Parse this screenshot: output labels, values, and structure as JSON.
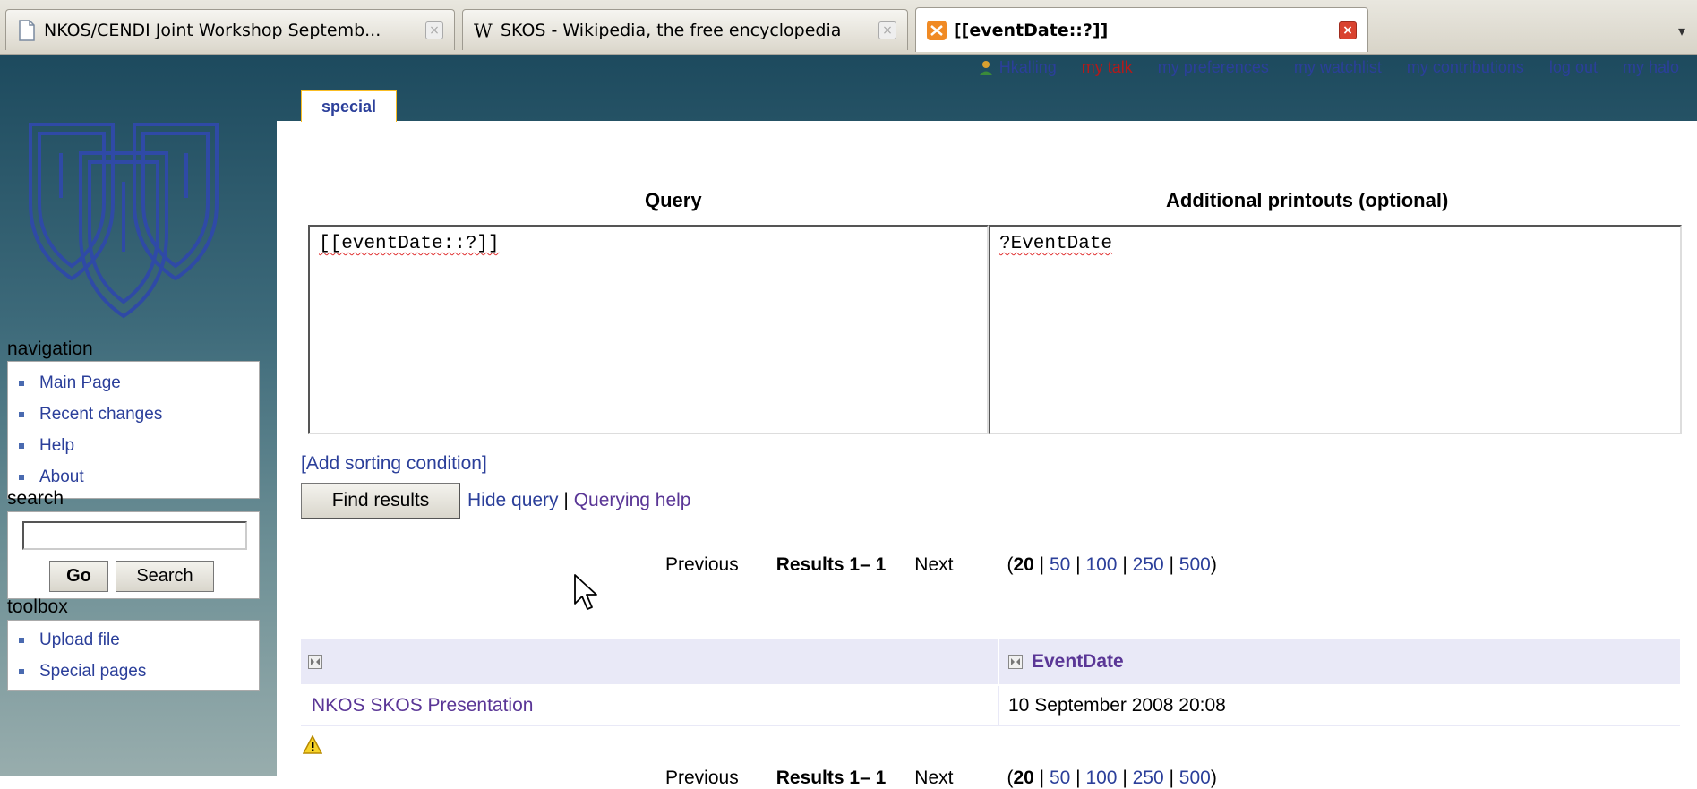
{
  "browser": {
    "tabs": [
      {
        "title": "NKOS/CENDI Joint Workshop Septemb...",
        "icon": "page-icon",
        "active": false
      },
      {
        "title": "SKOS - Wikipedia, the free encyclopedia",
        "icon": "wikipedia-icon",
        "active": false
      },
      {
        "title": "[[eventDate::?]]",
        "icon": "xampp-icon",
        "active": true
      }
    ],
    "close_glyph": "×",
    "scroll_glyph": "▾"
  },
  "userlinks": {
    "user": "Hkalling",
    "talk": "my talk",
    "preferences": "my preferences",
    "watchlist": "my watchlist",
    "contributions": "my contributions",
    "logout": "log out",
    "halo": "my halo"
  },
  "content_actions": {
    "special": "special"
  },
  "query_form": {
    "query_heading": "Query",
    "printouts_heading": "Additional printouts (optional)",
    "query_value": "[[eventDate::?]]",
    "printouts_value": "?EventDate",
    "add_sorting": "[Add sorting condition]",
    "find_button": "Find results",
    "hide_query": "Hide query",
    "separator": "|",
    "querying_help": "Querying help"
  },
  "results_nav": {
    "previous": "Previous",
    "results_label": "Results 1– 1",
    "next": "Next",
    "limit_open": "(",
    "limit_current": "20",
    "limits": [
      "50",
      "100",
      "250",
      "500"
    ],
    "limit_sep": " | ",
    "limit_close": ")"
  },
  "results_table": {
    "columns": [
      "",
      "EventDate"
    ],
    "rows": [
      {
        "page": "NKOS SKOS Presentation",
        "event_date": "10 September 2008 20:08"
      }
    ]
  },
  "sidebar": {
    "navigation": {
      "title": "navigation",
      "items": [
        "Main Page",
        "Recent changes",
        "Help",
        "About"
      ]
    },
    "search": {
      "title": "search",
      "value": "",
      "go_button": "Go",
      "search_button": "Search"
    },
    "toolbox": {
      "title": "toolbox",
      "items": [
        "Upload file",
        "Special pages"
      ]
    }
  }
}
